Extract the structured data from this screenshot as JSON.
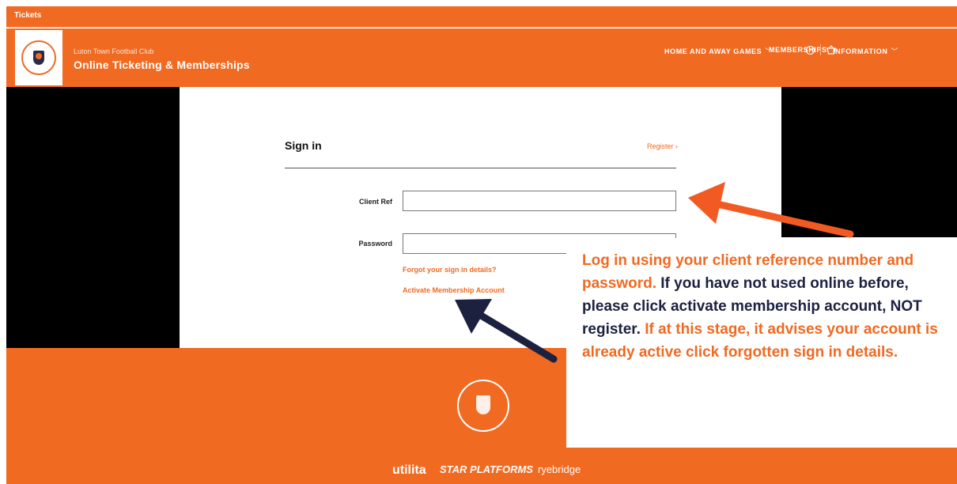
{
  "topbar": {
    "label": "Tickets"
  },
  "header": {
    "club_name": "Luton Town Football Club",
    "site_title": "Online Ticketing & Memberships",
    "nav": [
      {
        "label": "HOME AND AWAY GAMES",
        "dropdown": true
      },
      {
        "label": "MEMBERSHIPS",
        "dropdown": false
      },
      {
        "label": "INFORMATION",
        "dropdown": true
      }
    ],
    "icons": [
      "user-icon",
      "basket-icon"
    ]
  },
  "form": {
    "title": "Sign in",
    "register_label": "Register",
    "client_ref_label": "Client Ref",
    "client_ref_value": "",
    "password_label": "Password",
    "password_value": "",
    "forgot_link": "Forgot your sign in details?",
    "activate_link": "Activate Membership Account"
  },
  "footer": {
    "sponsors": [
      "utilita",
      "STAR PLATFORMS",
      "ryebridge"
    ]
  },
  "callout": {
    "part1": "Log in using your client reference number and password.",
    "part2": " If you have not used online before, please click activate membership account, NOT register.",
    "part3": " If at this stage, it advises your account is already active click forgotten sign in details."
  },
  "colors": {
    "brand_orange": "#f06a22",
    "navy": "#1c2140",
    "arrow_orange": "#f15a22"
  }
}
